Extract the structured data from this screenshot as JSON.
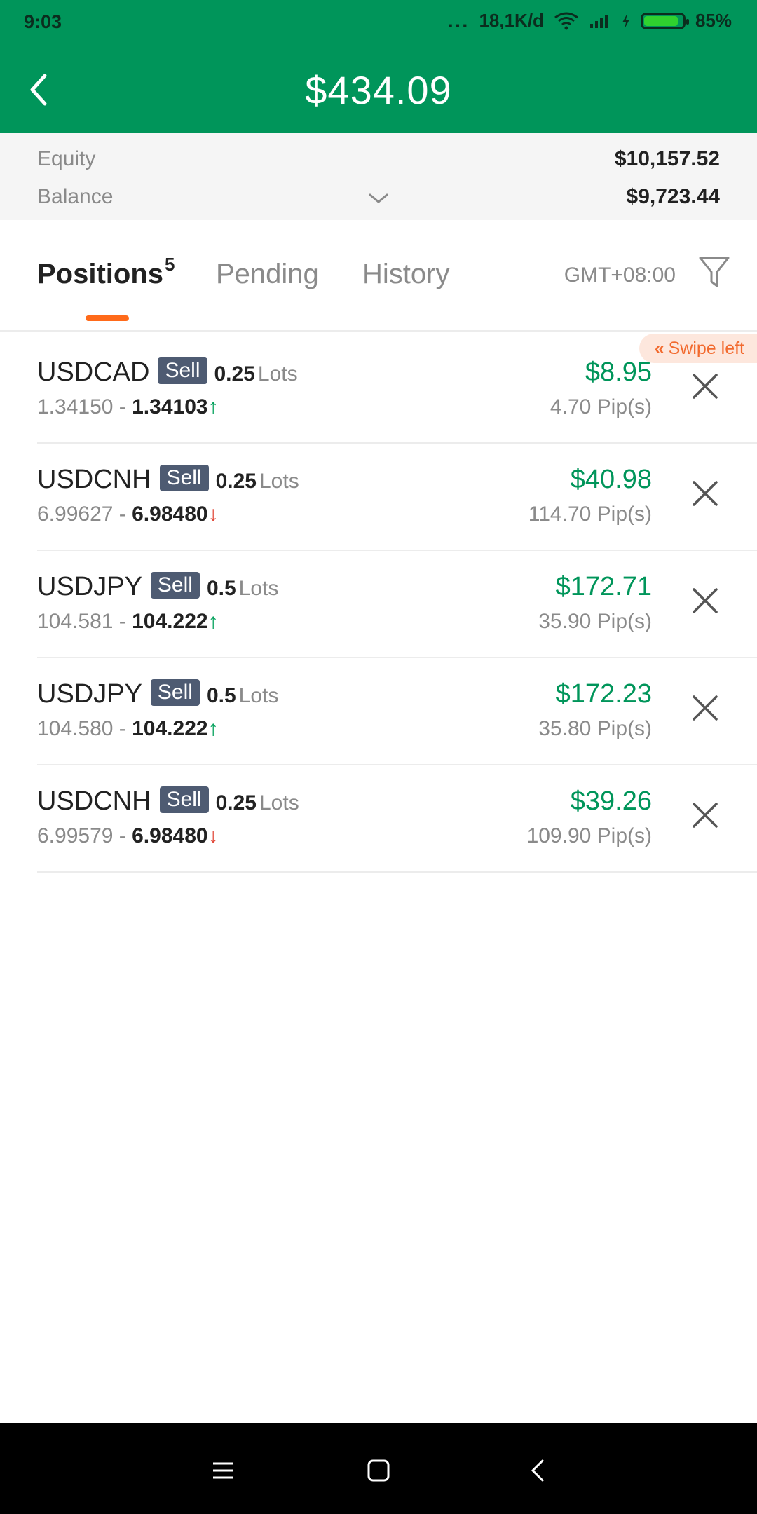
{
  "status_bar": {
    "time": "9:03",
    "dots": "...",
    "network_speed": "18,1K/d",
    "battery_percent": "85%"
  },
  "header": {
    "title": "$434.09"
  },
  "summary": {
    "equity_label": "Equity",
    "equity_value": "$10,157.52",
    "balance_label": "Balance",
    "balance_value": "$9,723.44"
  },
  "tabs": {
    "positions_label": "Positions",
    "positions_count": "5",
    "pending_label": "Pending",
    "history_label": "History",
    "timezone": "GMT+08:00"
  },
  "swipe_hint": "Swipe left",
  "positions": [
    {
      "symbol": "USDCAD",
      "side": "Sell",
      "lots": "0.25",
      "lots_label": "Lots",
      "open": "1.34150",
      "sep": " - ",
      "current": "1.34103",
      "trend": "↑",
      "pl": "$8.95",
      "pips": "4.70 Pip(s)"
    },
    {
      "symbol": "USDCNH",
      "side": "Sell",
      "lots": "0.25",
      "lots_label": "Lots",
      "open": "6.99627",
      "sep": " - ",
      "current": "6.98480",
      "trend": "↓",
      "pl": "$40.98",
      "pips": "114.70 Pip(s)"
    },
    {
      "symbol": "USDJPY",
      "side": "Sell",
      "lots": "0.5",
      "lots_label": "Lots",
      "open": "104.581",
      "sep": " - ",
      "current": "104.222",
      "trend": "↑",
      "pl": "$172.71",
      "pips": "35.90 Pip(s)"
    },
    {
      "symbol": "USDJPY",
      "side": "Sell",
      "lots": "0.5",
      "lots_label": "Lots",
      "open": "104.580",
      "sep": " - ",
      "current": "104.222",
      "trend": "↑",
      "pl": "$172.23",
      "pips": "35.80 Pip(s)"
    },
    {
      "symbol": "USDCNH",
      "side": "Sell",
      "lots": "0.25",
      "lots_label": "Lots",
      "open": "6.99579",
      "sep": " - ",
      "current": "6.98480",
      "trend": "↓",
      "pl": "$39.26",
      "pips": "109.90 Pip(s)"
    }
  ],
  "colors": {
    "header_bg": "#00955a",
    "profit": "#00955a",
    "accent": "#ff6a1a",
    "sell_badge": "#4e5b72",
    "up": "#00a05a",
    "down": "#e24a3b"
  },
  "icons": {
    "back": "chevron-left-icon",
    "expand": "chevron-down-icon",
    "filter": "filter-icon",
    "close": "close-icon"
  }
}
